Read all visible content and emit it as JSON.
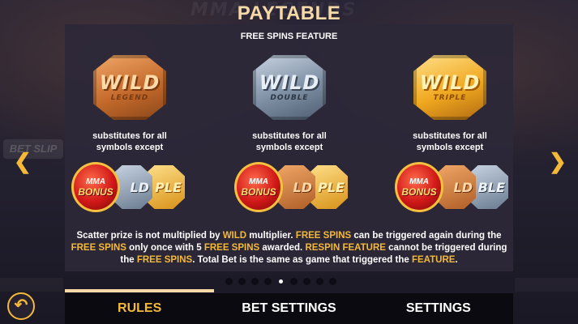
{
  "header": {
    "title": "PAYTABLE",
    "subtitle": "FREE SPINS FEATURE"
  },
  "background": {
    "watermark": "MMA LEGENDS",
    "bet_slip": "BET SLIP"
  },
  "symbols": [
    {
      "word": "WILD",
      "sub": "LEGEND",
      "style": "bronze",
      "desc1": "substitutes for all",
      "desc2": "symbols except"
    },
    {
      "word": "WILD",
      "sub": "DOUBLE",
      "style": "silver",
      "desc1": "substitutes for all",
      "desc2": "symbols except"
    },
    {
      "word": "WILD",
      "sub": "TRIPLE",
      "style": "gold",
      "desc1": "substitutes for all",
      "desc2": "symbols except"
    }
  ],
  "exceptions": [
    {
      "bonus_top": "MMA",
      "bonus_main": "BONUS",
      "second_text": "LD",
      "third_text": "PLE"
    },
    {
      "bonus_top": "MMA",
      "bonus_main": "BONUS",
      "second_text": "LD",
      "third_text": "PLE"
    },
    {
      "bonus_top": "MMA",
      "bonus_main": "BONUS",
      "second_text": "LD",
      "third_text": "BLE"
    }
  ],
  "scatter_text": {
    "p1": "Scatter prize is not multiplied by ",
    "h1": "WILD",
    "p2": " multiplier. ",
    "h2": "FREE SPINS",
    "p3": " can be triggered again during the",
    "h3": "FREE SPINS",
    "p4": " only once with 5 ",
    "h4": "FREE SPINS",
    "p5": " awarded. ",
    "h5": "RESPIN FEATURE",
    "p6": " cannot be triggered during",
    "p7": "the ",
    "h6": "FREE SPINS",
    "p8": ". Total Bet is the same as game that triggered the ",
    "h7": "FEATURE",
    "p9": "."
  },
  "pagination": {
    "total": 9,
    "current_index": 4
  },
  "tabs": [
    {
      "label": "RULES",
      "active": true
    },
    {
      "label": "BET SETTINGS",
      "active": false
    },
    {
      "label": "SETTINGS",
      "active": false
    }
  ],
  "nav": {
    "prev_icon": "chevron-left-icon",
    "next_icon": "chevron-right-icon",
    "back_icon": "back-arrow-icon"
  },
  "colors": {
    "accent": "#f5b93a",
    "title": "#f5d9a6",
    "panel": "#2c2838"
  }
}
